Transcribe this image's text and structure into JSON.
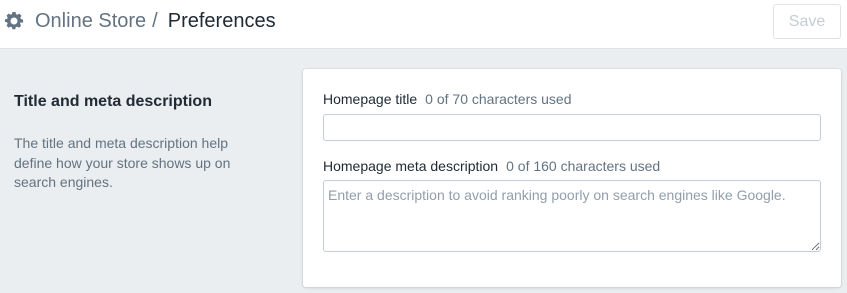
{
  "header": {
    "breadcrumb_parent": "Online Store",
    "separator": "/",
    "page_title": "Preferences",
    "save_label": "Save",
    "icon": "gear-icon"
  },
  "section": {
    "title": "Title and meta description",
    "description": "The title and meta description help define how your store shows up on search engines."
  },
  "form": {
    "homepage_title": {
      "label": "Homepage title",
      "counter": "0 of 70 characters used",
      "value": ""
    },
    "meta_description": {
      "label": "Homepage meta description",
      "counter": "0 of 160 characters used",
      "placeholder": "Enter a description to avoid ranking poorly on search engines like Google.",
      "value": ""
    }
  },
  "colors": {
    "background": "#ebeef0",
    "text": "#212b36",
    "muted": "#637381",
    "border": "#c4cdd5",
    "disabled_text": "#c4cdd5"
  }
}
